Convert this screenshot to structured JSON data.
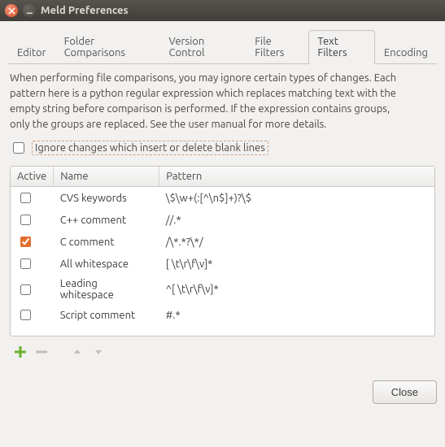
{
  "window": {
    "title": "Meld Preferences"
  },
  "tabs": [
    "Editor",
    "Folder Comparisons",
    "Version Control",
    "File Filters",
    "Text Filters",
    "Encoding"
  ],
  "active_tab": "Text Filters",
  "description": "When performing file comparisons, you may ignore certain types of changes. Each pattern here is a python regular expression which replaces matching text with the empty string before comparison is performed. If the expression contains groups, only the groups are replaced. See the user manual for more details.",
  "ignore_checkbox_label": "Ignore changes which insert or delete blank lines",
  "ignore_checkbox_checked": false,
  "columns": {
    "active": "Active",
    "name": "Name",
    "pattern": "Pattern"
  },
  "rows": [
    {
      "active": false,
      "name": "CVS keywords",
      "pattern": "\\$\\w+(:[^\\n$]+)?\\$"
    },
    {
      "active": false,
      "name": "C++ comment",
      "pattern": "//.*"
    },
    {
      "active": true,
      "name": "C comment",
      "pattern": "/\\*.*?\\*/"
    },
    {
      "active": false,
      "name": "All whitespace",
      "pattern": "[ \\t\\r\\f\\v]*"
    },
    {
      "active": false,
      "name": "Leading whitespace",
      "pattern": "^[ \\t\\r\\f\\v]*"
    },
    {
      "active": false,
      "name": "Script comment",
      "pattern": "#.*"
    }
  ],
  "buttons": {
    "close": "Close"
  }
}
